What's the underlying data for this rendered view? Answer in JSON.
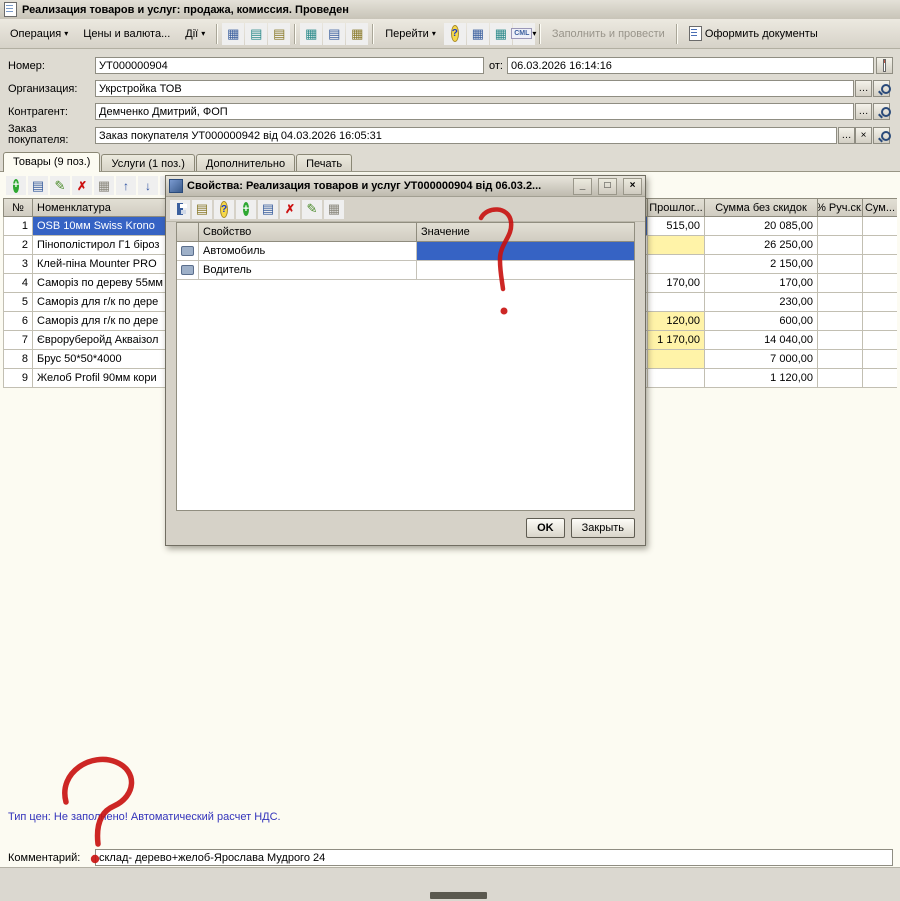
{
  "icons": {
    "dropdown": "▾",
    "plus": "+",
    "edit": "✎",
    "delete": "✗",
    "doc": "▤",
    "grid": "▦",
    "up": "↑",
    "down": "↓",
    "help": "?",
    "dots": "…",
    "clear": "×",
    "xml": "CML",
    "minimize": "_",
    "maximize": "□",
    "close": "×"
  },
  "window": {
    "title": "Реализация товаров и услуг: продажа, комиссия. Проведен"
  },
  "main_toolbar": {
    "operation": "Операция",
    "prices_currency": "Цены и валюта...",
    "actions": "Дії",
    "goto": "Перейти",
    "fill_and_post": "Заполнить и провести",
    "make_documents": "Оформить документы"
  },
  "fields": {
    "number": {
      "label": "Номер:",
      "value": "УТ000000904"
    },
    "date": {
      "label": "от:",
      "value": "06.03.2026 16:14:16"
    },
    "organization": {
      "label": "Организация:",
      "value": "Укрстройка ТОВ"
    },
    "contractor": {
      "label": "Контрагент:",
      "value": "Демченко Дмитрий, ФОП"
    },
    "order": {
      "label": "Заказ покупателя:",
      "value": "Заказ покупателя УТ000000942 від 04.03.2026 16:05:31"
    }
  },
  "tabs": [
    {
      "label": "Товары (9 поз.)",
      "active": true
    },
    {
      "label": "Услуги (1 поз.)",
      "active": false
    },
    {
      "label": "Дополнительно",
      "active": false
    },
    {
      "label": "Печать",
      "active": false
    }
  ],
  "items_table": {
    "headers": {
      "num": "№",
      "nomenclature": "Номенклатура",
      "price": "Прошлог...",
      "sum_no_discount": "Сумма без скидок",
      "manual_discount": "% Руч.ск.",
      "sum": "Сум..."
    },
    "rows": [
      {
        "num": "1",
        "name": "OSB  10мм Swiss Krono",
        "price": "515,00",
        "sum": "20 085,00",
        "selected": true,
        "price_yellow": false
      },
      {
        "num": "2",
        "name": "Пінополістирол Г1 біроз",
        "price": "",
        "sum": "26 250,00",
        "selected": false,
        "price_yellow": true
      },
      {
        "num": "3",
        "name": "Клей-піна Mounter PRO",
        "price": "",
        "sum": "2 150,00",
        "selected": false,
        "price_yellow": false
      },
      {
        "num": "4",
        "name": "Саморіз по дереву 55мм",
        "price": "170,00",
        "sum": "170,00",
        "selected": false,
        "price_yellow": false
      },
      {
        "num": "5",
        "name": "Саморіз для г/к по дере",
        "price": "",
        "sum": "230,00",
        "selected": false,
        "price_yellow": false
      },
      {
        "num": "6",
        "name": "Саморіз для г/к по дере",
        "price": "120,00",
        "sum": "600,00",
        "selected": false,
        "price_yellow": true
      },
      {
        "num": "7",
        "name": "Євроруберойд Акваізол",
        "price": "1 170,00",
        "sum": "14 040,00",
        "selected": false,
        "price_yellow": true
      },
      {
        "num": "8",
        "name": "Брус 50*50*4000",
        "price": "",
        "sum": "7 000,00",
        "selected": false,
        "price_yellow": true
      },
      {
        "num": "9",
        "name": "Желоб Profil 90мм кори",
        "price": "",
        "sum": "1 120,00",
        "selected": false,
        "price_yellow": false
      }
    ]
  },
  "dialog": {
    "title": "Свойства: Реализация товаров и услуг УТ000000904 від 06.03.2...",
    "columns": {
      "property": "Свойство",
      "value": "Значение"
    },
    "rows": [
      {
        "property": "Автомобиль",
        "value": "",
        "value_selected": true
      },
      {
        "property": "Водитель",
        "value": "",
        "value_selected": false
      }
    ],
    "ok": "OK",
    "close": "Закрыть"
  },
  "footer": {
    "price_type_info": "Тип цен: Не заполнено! Автоматический расчет НДС.",
    "comment": {
      "label": "Комментарий:",
      "value": "склад- дерево+желоб-Ярослава Мудрого 24"
    }
  }
}
